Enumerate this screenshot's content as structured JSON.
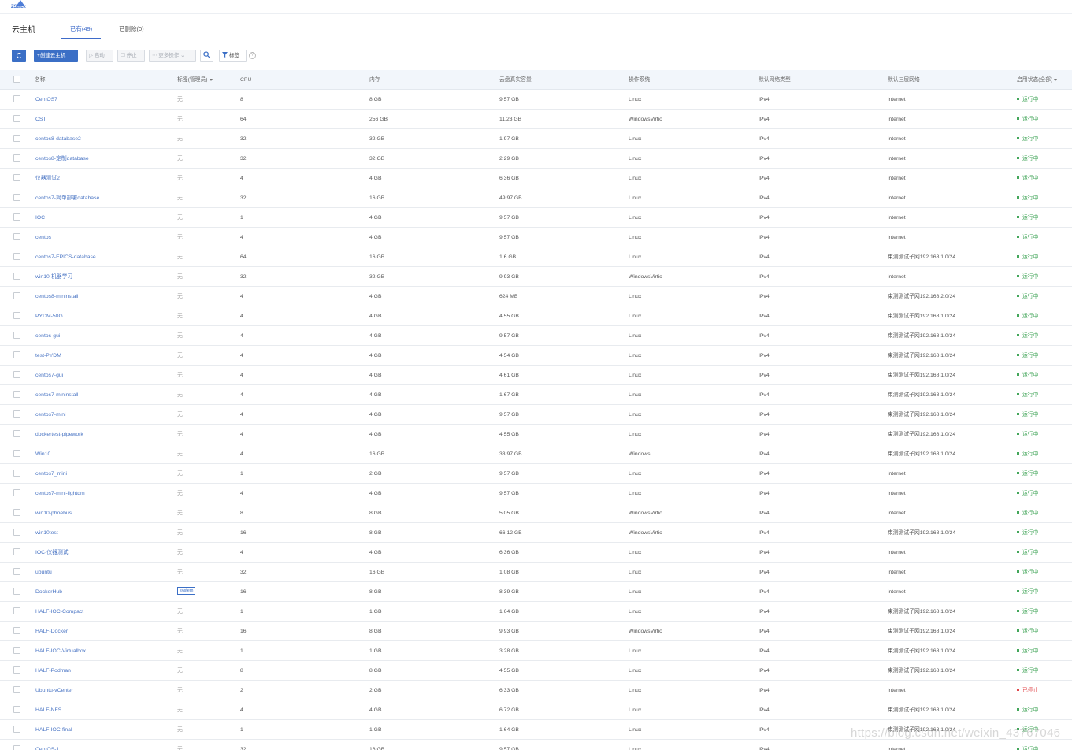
{
  "app": {
    "logo_text": "ZStack"
  },
  "page": {
    "title": "云主机"
  },
  "tabs": [
    {
      "label": "已有(49)"
    },
    {
      "label": "已删除(0)"
    }
  ],
  "toolbar": {
    "create_label": "+创建云主机",
    "start_label": "▷ 启动",
    "stop_label": "☐ 停止",
    "more_label": "⋯ 更多操作 ⌄",
    "tag_label": "标签",
    "help_label": "?"
  },
  "table": {
    "columns": {
      "name": "名称",
      "tag": "标签(管理员)",
      "cpu": "CPU",
      "memory": "内存",
      "disk": "云盘真实容量",
      "os": "操作系统",
      "net_type": "默认网络类型",
      "l3": "默认三层网络",
      "state": "启用状态(全部)"
    },
    "rows": [
      {
        "name": "CentOS7",
        "tag": "无",
        "cpu": "8",
        "memory": "8 GB",
        "disk": "9.57 GB",
        "os": "Linux",
        "net_type": "IPv4",
        "l3": "internet",
        "state": "运行中",
        "running": true
      },
      {
        "name": "CST",
        "tag": "无",
        "cpu": "64",
        "memory": "256 GB",
        "disk": "11.23 GB",
        "os": "WindowsVirtio",
        "net_type": "IPv4",
        "l3": "internet",
        "state": "运行中",
        "running": true
      },
      {
        "name": "centos8-database2",
        "tag": "无",
        "cpu": "32",
        "memory": "32 GB",
        "disk": "1.97 GB",
        "os": "Linux",
        "net_type": "IPv4",
        "l3": "internet",
        "state": "运行中",
        "running": true
      },
      {
        "name": "centos8-定制database",
        "tag": "无",
        "cpu": "32",
        "memory": "32 GB",
        "disk": "2.29 GB",
        "os": "Linux",
        "net_type": "IPv4",
        "l3": "internet",
        "state": "运行中",
        "running": true
      },
      {
        "name": "仪器测试2",
        "tag": "无",
        "cpu": "4",
        "memory": "4 GB",
        "disk": "6.36 GB",
        "os": "Linux",
        "net_type": "IPv4",
        "l3": "internet",
        "state": "运行中",
        "running": true
      },
      {
        "name": "centos7-简单部署database",
        "tag": "无",
        "cpu": "32",
        "memory": "16 GB",
        "disk": "49.97 GB",
        "os": "Linux",
        "net_type": "IPv4",
        "l3": "internet",
        "state": "运行中",
        "running": true
      },
      {
        "name": "IOC",
        "tag": "无",
        "cpu": "1",
        "memory": "4 GB",
        "disk": "9.57 GB",
        "os": "Linux",
        "net_type": "IPv4",
        "l3": "internet",
        "state": "运行中",
        "running": true
      },
      {
        "name": "centos",
        "tag": "无",
        "cpu": "4",
        "memory": "4 GB",
        "disk": "9.57 GB",
        "os": "Linux",
        "net_type": "IPv4",
        "l3": "internet",
        "state": "运行中",
        "running": true
      },
      {
        "name": "centos7-EPICS-database",
        "tag": "无",
        "cpu": "64",
        "memory": "16 GB",
        "disk": "1.6 GB",
        "os": "Linux",
        "net_type": "IPv4",
        "l3": "束测测试子网192.168.1.0/24",
        "state": "运行中",
        "running": true
      },
      {
        "name": "win10-机器学习",
        "tag": "无",
        "cpu": "32",
        "memory": "32 GB",
        "disk": "9.93 GB",
        "os": "WindowsVirtio",
        "net_type": "IPv4",
        "l3": "internet",
        "state": "运行中",
        "running": true
      },
      {
        "name": "centos8-mininstall",
        "tag": "无",
        "cpu": "4",
        "memory": "4 GB",
        "disk": "624 MB",
        "os": "Linux",
        "net_type": "IPv4",
        "l3": "束测测试子网192.168.2.0/24",
        "state": "运行中",
        "running": true
      },
      {
        "name": "PYDM-50G",
        "tag": "无",
        "cpu": "4",
        "memory": "4 GB",
        "disk": "4.55 GB",
        "os": "Linux",
        "net_type": "IPv4",
        "l3": "束测测试子网192.168.1.0/24",
        "state": "运行中",
        "running": true
      },
      {
        "name": "centos-gui",
        "tag": "无",
        "cpu": "4",
        "memory": "4 GB",
        "disk": "9.57 GB",
        "os": "Linux",
        "net_type": "IPv4",
        "l3": "束测测试子网192.168.1.0/24",
        "state": "运行中",
        "running": true
      },
      {
        "name": "test-PYDM",
        "tag": "无",
        "cpu": "4",
        "memory": "4 GB",
        "disk": "4.54 GB",
        "os": "Linux",
        "net_type": "IPv4",
        "l3": "束测测试子网192.168.1.0/24",
        "state": "运行中",
        "running": true
      },
      {
        "name": "centos7-gui",
        "tag": "无",
        "cpu": "4",
        "memory": "4 GB",
        "disk": "4.61 GB",
        "os": "Linux",
        "net_type": "IPv4",
        "l3": "束测测试子网192.168.1.0/24",
        "state": "运行中",
        "running": true
      },
      {
        "name": "centos7-mininstall",
        "tag": "无",
        "cpu": "4",
        "memory": "4 GB",
        "disk": "1.67 GB",
        "os": "Linux",
        "net_type": "IPv4",
        "l3": "束测测试子网192.168.1.0/24",
        "state": "运行中",
        "running": true
      },
      {
        "name": "centos7-mini",
        "tag": "无",
        "cpu": "4",
        "memory": "4 GB",
        "disk": "9.57 GB",
        "os": "Linux",
        "net_type": "IPv4",
        "l3": "束测测试子网192.168.1.0/24",
        "state": "运行中",
        "running": true
      },
      {
        "name": "dockertest-pipework",
        "tag": "无",
        "cpu": "4",
        "memory": "4 GB",
        "disk": "4.55 GB",
        "os": "Linux",
        "net_type": "IPv4",
        "l3": "束测测试子网192.168.1.0/24",
        "state": "运行中",
        "running": true
      },
      {
        "name": "Win10",
        "tag": "无",
        "cpu": "4",
        "memory": "16 GB",
        "disk": "33.97 GB",
        "os": "Windows",
        "net_type": "IPv4",
        "l3": "束测测试子网192.168.1.0/24",
        "state": "运行中",
        "running": true
      },
      {
        "name": "centos7_mini",
        "tag": "无",
        "cpu": "1",
        "memory": "2 GB",
        "disk": "9.57 GB",
        "os": "Linux",
        "net_type": "IPv4",
        "l3": "internet",
        "state": "运行中",
        "running": true
      },
      {
        "name": "centos7-mini-lightdm",
        "tag": "无",
        "cpu": "4",
        "memory": "4 GB",
        "disk": "9.57 GB",
        "os": "Linux",
        "net_type": "IPv4",
        "l3": "internet",
        "state": "运行中",
        "running": true
      },
      {
        "name": "win10-phoebus",
        "tag": "无",
        "cpu": "8",
        "memory": "8 GB",
        "disk": "5.05 GB",
        "os": "WindowsVirtio",
        "net_type": "IPv4",
        "l3": "internet",
        "state": "运行中",
        "running": true
      },
      {
        "name": "win10test",
        "tag": "无",
        "cpu": "16",
        "memory": "8 GB",
        "disk": "66.12 GB",
        "os": "WindowsVirtio",
        "net_type": "IPv4",
        "l3": "束测测试子网192.168.1.0/24",
        "state": "运行中",
        "running": true
      },
      {
        "name": "IOC-仪器测试",
        "tag": "无",
        "cpu": "4",
        "memory": "4 GB",
        "disk": "6.36 GB",
        "os": "Linux",
        "net_type": "IPv4",
        "l3": "internet",
        "state": "运行中",
        "running": true
      },
      {
        "name": "ubuntu",
        "tag": "无",
        "cpu": "32",
        "memory": "16 GB",
        "disk": "1.08 GB",
        "os": "Linux",
        "net_type": "IPv4",
        "l3": "internet",
        "state": "运行中",
        "running": true
      },
      {
        "name": "DockerHub",
        "tag": "system",
        "tag_chip": true,
        "cpu": "16",
        "memory": "8 GB",
        "disk": "8.39 GB",
        "os": "Linux",
        "net_type": "IPv4",
        "l3": "internet",
        "state": "运行中",
        "running": true
      },
      {
        "name": "HALF-IOC-Compact",
        "tag": "无",
        "cpu": "1",
        "memory": "1 GB",
        "disk": "1.64 GB",
        "os": "Linux",
        "net_type": "IPv4",
        "l3": "束测测试子网192.168.1.0/24",
        "state": "运行中",
        "running": true
      },
      {
        "name": "HALF-Docker",
        "tag": "无",
        "cpu": "16",
        "memory": "8 GB",
        "disk": "9.93 GB",
        "os": "WindowsVirtio",
        "net_type": "IPv4",
        "l3": "束测测试子网192.168.1.0/24",
        "state": "运行中",
        "running": true
      },
      {
        "name": "HALF-IOC-Virtualbox",
        "tag": "无",
        "cpu": "1",
        "memory": "1 GB",
        "disk": "3.28 GB",
        "os": "Linux",
        "net_type": "IPv4",
        "l3": "束测测试子网192.168.1.0/24",
        "state": "运行中",
        "running": true
      },
      {
        "name": "HALF-Podman",
        "tag": "无",
        "cpu": "8",
        "memory": "8 GB",
        "disk": "4.55 GB",
        "os": "Linux",
        "net_type": "IPv4",
        "l3": "束测测试子网192.168.1.0/24",
        "state": "运行中",
        "running": true
      },
      {
        "name": "Ubuntu-vCenter",
        "tag": "无",
        "cpu": "2",
        "memory": "2 GB",
        "disk": "6.33 GB",
        "os": "Linux",
        "net_type": "IPv4",
        "l3": "internet",
        "state": "已停止",
        "running": false
      },
      {
        "name": "HALF-NFS",
        "tag": "无",
        "cpu": "4",
        "memory": "4 GB",
        "disk": "6.72 GB",
        "os": "Linux",
        "net_type": "IPv4",
        "l3": "束测测试子网192.168.1.0/24",
        "state": "运行中",
        "running": true
      },
      {
        "name": "HALF-IOC-final",
        "tag": "无",
        "cpu": "1",
        "memory": "1 GB",
        "disk": "1.64 GB",
        "os": "Linux",
        "net_type": "IPv4",
        "l3": "束测测试子网192.168.1.0/24",
        "state": "运行中",
        "running": true
      },
      {
        "name": "CentOS-1",
        "tag": "无",
        "cpu": "32",
        "memory": "16 GB",
        "disk": "9.57 GB",
        "os": "Linux",
        "net_type": "IPv4",
        "l3": "internet",
        "state": "运行中",
        "running": true
      }
    ]
  },
  "watermark": "https://blog.csdn.net/weixin_43767046",
  "colors": {
    "primary": "#3b6fc6",
    "running": "#43a65a",
    "stopped": "#e0474b",
    "link": "#4a75c4",
    "header_bg": "#f2f6fb"
  }
}
